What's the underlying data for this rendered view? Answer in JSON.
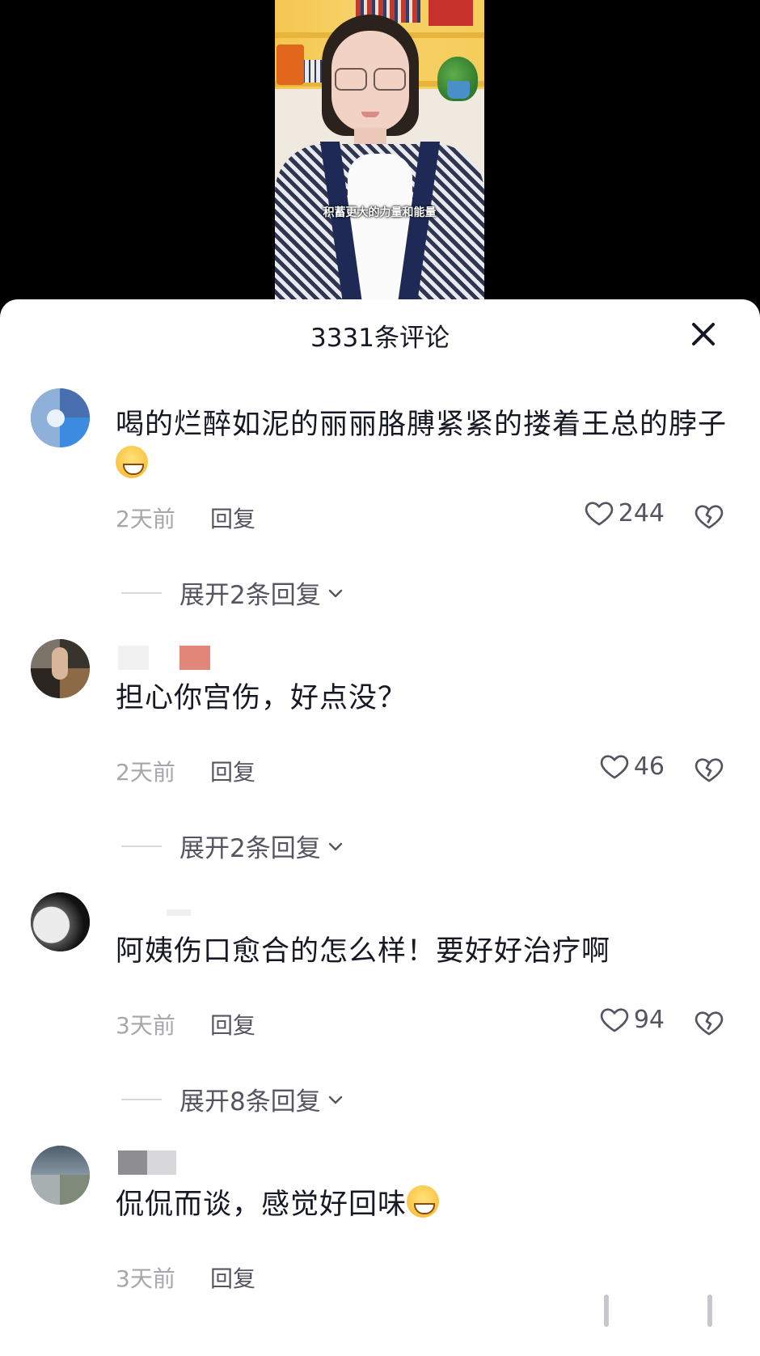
{
  "video": {
    "subtitle": "积蓄更大的力量和能量"
  },
  "sheet": {
    "title": "3331条评论",
    "close_icon": "close-icon"
  },
  "comments": [
    {
      "text": "喝的烂醉如泥的丽丽胳膊紧紧的搂着王总的脖子",
      "emoji": "laugh-cry-emoji",
      "time": "2天前",
      "reply_label": "回复",
      "likes": "244",
      "expand_label": "展开2条回复"
    },
    {
      "text": "担心你宫伤，好点没？",
      "time": "2天前",
      "reply_label": "回复",
      "likes": "46",
      "expand_label": "展开2条回复"
    },
    {
      "text": "阿姨伤口愈合的怎么样！要好好治疗啊",
      "time": "3天前",
      "reply_label": "回复",
      "likes": "94",
      "expand_label": "展开8条回复"
    },
    {
      "text": "侃侃而谈，感觉好回味",
      "emoji": "grin-emoji",
      "time": "3天前",
      "reply_label": "回复"
    }
  ],
  "colors": {
    "text_primary": "#161823",
    "text_secondary": "#a7a7ab",
    "text_action": "#545560"
  }
}
